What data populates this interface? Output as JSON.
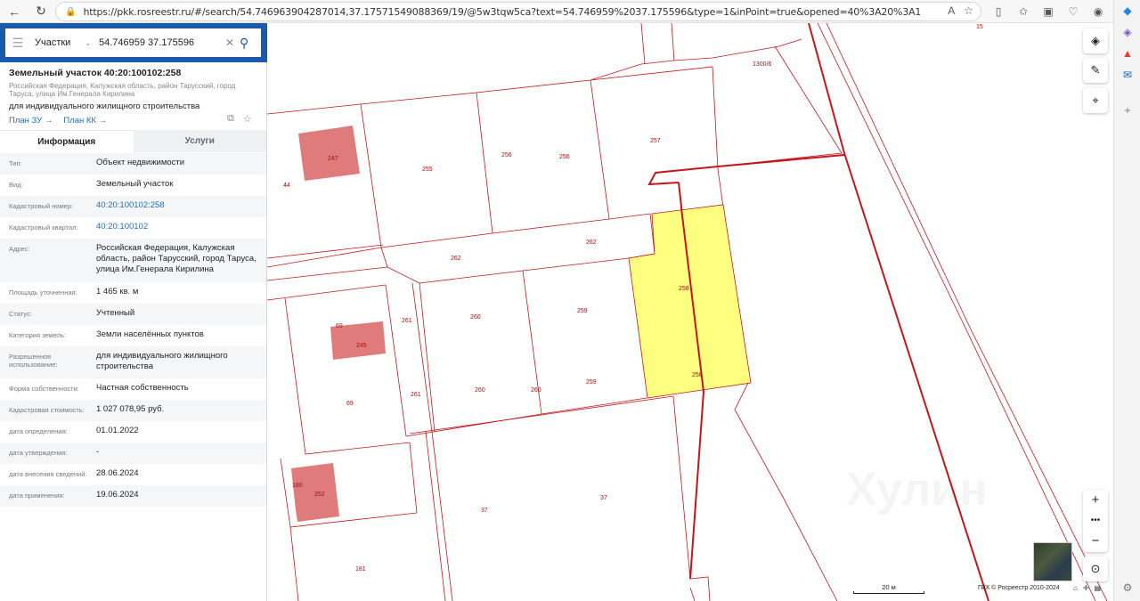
{
  "browser": {
    "url": "https://pkk.rosreestr.ru/#/search/54.746963904287014,37.17571549088369/19/@5w3tqw5ca?text=54.746959%2037.175596&type=1&inPoint=true&opened=40%3A20%3A100102%3A258",
    "icons": [
      "back-icon",
      "refresh-icon",
      "lock-icon",
      "read-aloud-icon",
      "star-icon",
      "split-icon",
      "favorites-icon",
      "collections-icon",
      "extensions-icon",
      "profile-icon",
      "more-icon"
    ]
  },
  "search": {
    "category": "Участки",
    "query": "54.746959 37.175596"
  },
  "plot": {
    "title": "Земельный участок 40:20:100102:258",
    "address_short": "Российская Федерация, Калужская область, район Тарусский, город Таруса, улица Им.Генерала Кирилина",
    "use": "для индивидуального жилищного строительства",
    "link_zu": "План ЗУ →",
    "link_kk": "План КК →"
  },
  "tabs": [
    {
      "label": "Информация",
      "active": true
    },
    {
      "label": "Услуги",
      "active": false
    }
  ],
  "info": [
    {
      "k": "Тип:",
      "v": "Объект недвижимости"
    },
    {
      "k": "Вид:",
      "v": "Земельный участок"
    },
    {
      "k": "Кадастровый номер:",
      "v": "40:20:100102:258",
      "link": true
    },
    {
      "k": "Кадастровый квартал:",
      "v": "40:20:100102",
      "link": true
    },
    {
      "k": "Адрес:",
      "v": "Российская Федерация, Калужская область, район Тарусский, город Таруса, улица Им.Генерала Кирилина"
    },
    {
      "k": "Площадь уточненная:",
      "v": "1 465 кв. м"
    },
    {
      "k": "Статус:",
      "v": "Учтенный"
    },
    {
      "k": "Категория земель:",
      "v": "Земли населённых пунктов"
    },
    {
      "k": "Разрешенное использование:",
      "v": "для индивидуального жилищного строительства"
    },
    {
      "k": "Форма собственности:",
      "v": "Частная собственность"
    },
    {
      "k": "Кадастровая стоимость:",
      "v": "1 027 078,95 руб."
    },
    {
      "k": "дата определения:",
      "v": "01.01.2022"
    },
    {
      "k": "дата утверждения:",
      "v": "-"
    },
    {
      "k": "дата внесения сведений:",
      "v": "28.06.2024"
    },
    {
      "k": "дата применения:",
      "v": "19.06.2024"
    }
  ],
  "map": {
    "labels": [
      {
        "t": "15"
      },
      {
        "t": "1300/6"
      },
      {
        "t": "247"
      },
      {
        "t": "44"
      },
      {
        "t": "255"
      },
      {
        "t": "256"
      },
      {
        "t": "256"
      },
      {
        "t": "257"
      },
      {
        "t": "262"
      },
      {
        "t": "262"
      },
      {
        "t": "258"
      },
      {
        "t": "258"
      },
      {
        "t": "69"
      },
      {
        "t": "245"
      },
      {
        "t": "261"
      },
      {
        "t": "260"
      },
      {
        "t": "259"
      },
      {
        "t": "261"
      },
      {
        "t": "260"
      },
      {
        "t": "260"
      },
      {
        "t": "259"
      },
      {
        "t": "69"
      },
      {
        "t": "180"
      },
      {
        "t": "252"
      },
      {
        "t": "37"
      },
      {
        "t": "37"
      },
      {
        "t": "181"
      }
    ],
    "scale": "20 м",
    "copyright": "ПКК © Росреестр 2010-2024",
    "highlight_color": "#ffff80",
    "boundary_color": "#c4161c",
    "building_color": "#e07b7b"
  }
}
